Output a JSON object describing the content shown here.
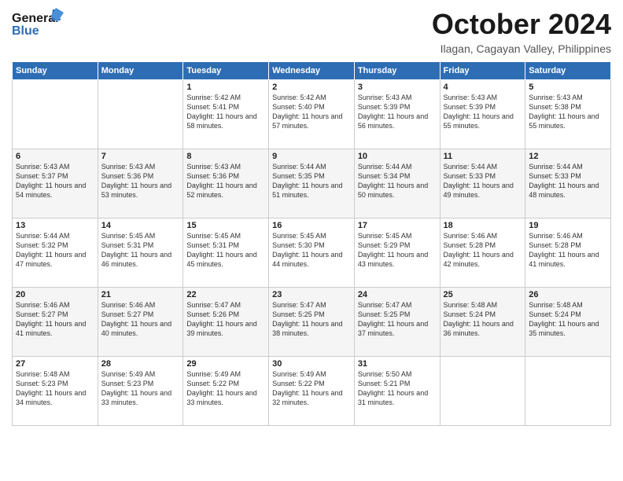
{
  "header": {
    "logo_line1": "General",
    "logo_line2": "Blue",
    "month_title": "October 2024",
    "location": "Ilagan, Cagayan Valley, Philippines"
  },
  "days_of_week": [
    "Sunday",
    "Monday",
    "Tuesday",
    "Wednesday",
    "Thursday",
    "Friday",
    "Saturday"
  ],
  "weeks": [
    [
      {
        "day": "",
        "info": ""
      },
      {
        "day": "",
        "info": ""
      },
      {
        "day": "1",
        "info": "Sunrise: 5:42 AM\nSunset: 5:41 PM\nDaylight: 11 hours and 58 minutes."
      },
      {
        "day": "2",
        "info": "Sunrise: 5:42 AM\nSunset: 5:40 PM\nDaylight: 11 hours and 57 minutes."
      },
      {
        "day": "3",
        "info": "Sunrise: 5:43 AM\nSunset: 5:39 PM\nDaylight: 11 hours and 56 minutes."
      },
      {
        "day": "4",
        "info": "Sunrise: 5:43 AM\nSunset: 5:39 PM\nDaylight: 11 hours and 55 minutes."
      },
      {
        "day": "5",
        "info": "Sunrise: 5:43 AM\nSunset: 5:38 PM\nDaylight: 11 hours and 55 minutes."
      }
    ],
    [
      {
        "day": "6",
        "info": "Sunrise: 5:43 AM\nSunset: 5:37 PM\nDaylight: 11 hours and 54 minutes."
      },
      {
        "day": "7",
        "info": "Sunrise: 5:43 AM\nSunset: 5:36 PM\nDaylight: 11 hours and 53 minutes."
      },
      {
        "day": "8",
        "info": "Sunrise: 5:43 AM\nSunset: 5:36 PM\nDaylight: 11 hours and 52 minutes."
      },
      {
        "day": "9",
        "info": "Sunrise: 5:44 AM\nSunset: 5:35 PM\nDaylight: 11 hours and 51 minutes."
      },
      {
        "day": "10",
        "info": "Sunrise: 5:44 AM\nSunset: 5:34 PM\nDaylight: 11 hours and 50 minutes."
      },
      {
        "day": "11",
        "info": "Sunrise: 5:44 AM\nSunset: 5:33 PM\nDaylight: 11 hours and 49 minutes."
      },
      {
        "day": "12",
        "info": "Sunrise: 5:44 AM\nSunset: 5:33 PM\nDaylight: 11 hours and 48 minutes."
      }
    ],
    [
      {
        "day": "13",
        "info": "Sunrise: 5:44 AM\nSunset: 5:32 PM\nDaylight: 11 hours and 47 minutes."
      },
      {
        "day": "14",
        "info": "Sunrise: 5:45 AM\nSunset: 5:31 PM\nDaylight: 11 hours and 46 minutes."
      },
      {
        "day": "15",
        "info": "Sunrise: 5:45 AM\nSunset: 5:31 PM\nDaylight: 11 hours and 45 minutes."
      },
      {
        "day": "16",
        "info": "Sunrise: 5:45 AM\nSunset: 5:30 PM\nDaylight: 11 hours and 44 minutes."
      },
      {
        "day": "17",
        "info": "Sunrise: 5:45 AM\nSunset: 5:29 PM\nDaylight: 11 hours and 43 minutes."
      },
      {
        "day": "18",
        "info": "Sunrise: 5:46 AM\nSunset: 5:28 PM\nDaylight: 11 hours and 42 minutes."
      },
      {
        "day": "19",
        "info": "Sunrise: 5:46 AM\nSunset: 5:28 PM\nDaylight: 11 hours and 41 minutes."
      }
    ],
    [
      {
        "day": "20",
        "info": "Sunrise: 5:46 AM\nSunset: 5:27 PM\nDaylight: 11 hours and 41 minutes."
      },
      {
        "day": "21",
        "info": "Sunrise: 5:46 AM\nSunset: 5:27 PM\nDaylight: 11 hours and 40 minutes."
      },
      {
        "day": "22",
        "info": "Sunrise: 5:47 AM\nSunset: 5:26 PM\nDaylight: 11 hours and 39 minutes."
      },
      {
        "day": "23",
        "info": "Sunrise: 5:47 AM\nSunset: 5:25 PM\nDaylight: 11 hours and 38 minutes."
      },
      {
        "day": "24",
        "info": "Sunrise: 5:47 AM\nSunset: 5:25 PM\nDaylight: 11 hours and 37 minutes."
      },
      {
        "day": "25",
        "info": "Sunrise: 5:48 AM\nSunset: 5:24 PM\nDaylight: 11 hours and 36 minutes."
      },
      {
        "day": "26",
        "info": "Sunrise: 5:48 AM\nSunset: 5:24 PM\nDaylight: 11 hours and 35 minutes."
      }
    ],
    [
      {
        "day": "27",
        "info": "Sunrise: 5:48 AM\nSunset: 5:23 PM\nDaylight: 11 hours and 34 minutes."
      },
      {
        "day": "28",
        "info": "Sunrise: 5:49 AM\nSunset: 5:23 PM\nDaylight: 11 hours and 33 minutes."
      },
      {
        "day": "29",
        "info": "Sunrise: 5:49 AM\nSunset: 5:22 PM\nDaylight: 11 hours and 33 minutes."
      },
      {
        "day": "30",
        "info": "Sunrise: 5:49 AM\nSunset: 5:22 PM\nDaylight: 11 hours and 32 minutes."
      },
      {
        "day": "31",
        "info": "Sunrise: 5:50 AM\nSunset: 5:21 PM\nDaylight: 11 hours and 31 minutes."
      },
      {
        "day": "",
        "info": ""
      },
      {
        "day": "",
        "info": ""
      }
    ]
  ]
}
